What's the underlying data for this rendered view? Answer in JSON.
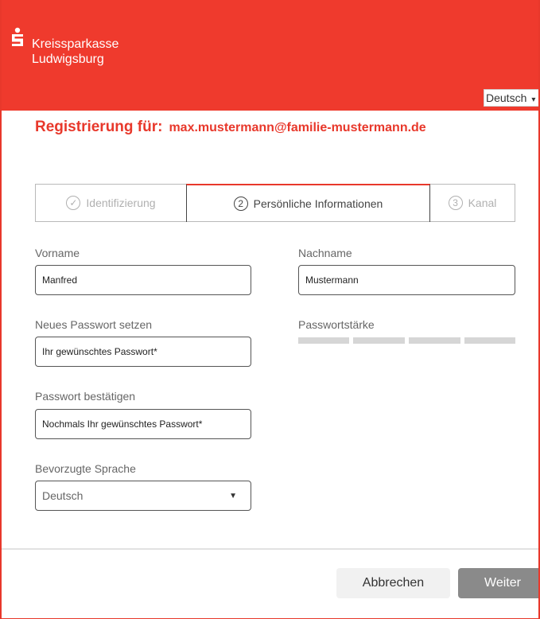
{
  "header": {
    "brand_line1": "Kreissparkasse",
    "brand_line2": "Ludwigsburg",
    "language": "Deutsch"
  },
  "registration": {
    "label": "Registrierung für:",
    "email": "max.mustermann@familie-mustermann.de"
  },
  "steps": [
    {
      "symbol": "✓",
      "label": "Identifizierung",
      "state": "done"
    },
    {
      "symbol": "2",
      "label": "Persönliche Informationen",
      "state": "active"
    },
    {
      "symbol": "3",
      "label": "Kanal",
      "state": "upcoming"
    }
  ],
  "form": {
    "firstname": {
      "label": "Vorname",
      "value": "Manfred"
    },
    "lastname": {
      "label": "Nachname",
      "value": "Mustermann"
    },
    "new_password": {
      "label": "Neues Passwort setzen",
      "placeholder": "Ihr gewünschtes Passwort*"
    },
    "password_strength": {
      "label": "Passwortstärke",
      "level": 0,
      "segments": 4
    },
    "confirm_password": {
      "label": "Passwort bestätigen",
      "placeholder": "Nochmals Ihr gewünschtes Passwort*"
    },
    "preferred_language": {
      "label": "Bevorzugte Sprache",
      "value": "Deutsch"
    }
  },
  "buttons": {
    "cancel": "Abbrechen",
    "next": "Weiter"
  },
  "colors": {
    "brand_red": "#ef3a2d",
    "accent_red": "#e8382b",
    "disabled_button": "#8a8a8a"
  },
  "icons": {
    "logo": "sparkasse-s-logo-icon",
    "dropdown": "chevron-down-icon"
  }
}
